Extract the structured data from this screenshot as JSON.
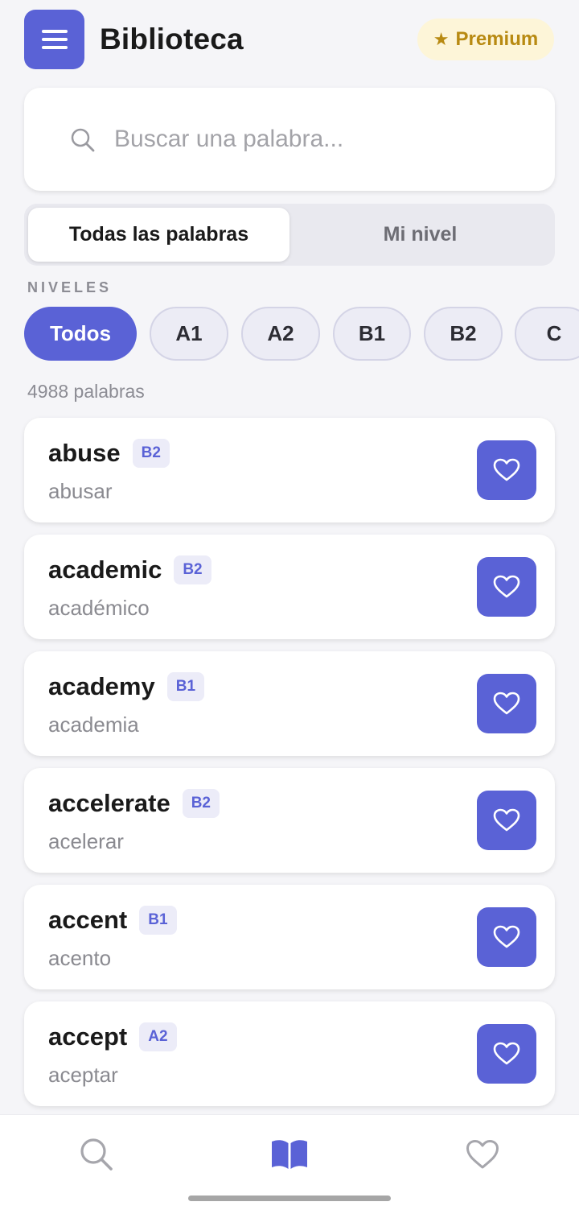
{
  "header": {
    "title": "Biblioteca",
    "premium_label": "Premium"
  },
  "search": {
    "placeholder": "Buscar una palabra...",
    "value": ""
  },
  "tabs": [
    {
      "label": "Todas las palabras",
      "active": true
    },
    {
      "label": "Mi nivel",
      "active": false
    }
  ],
  "levels": {
    "section_label": "NIVELES",
    "chips": [
      {
        "label": "Todos",
        "active": true
      },
      {
        "label": "A1",
        "active": false
      },
      {
        "label": "A2",
        "active": false
      },
      {
        "label": "B1",
        "active": false
      },
      {
        "label": "B2",
        "active": false
      },
      {
        "label": "C",
        "active": false
      }
    ]
  },
  "word_count": "4988 palabras",
  "words": [
    {
      "word": "abuse",
      "level": "B2",
      "translation": "abusar"
    },
    {
      "word": "academic",
      "level": "B2",
      "translation": "académico"
    },
    {
      "word": "academy",
      "level": "B1",
      "translation": "academia"
    },
    {
      "word": "accelerate",
      "level": "B2",
      "translation": "acelerar"
    },
    {
      "word": "accent",
      "level": "B1",
      "translation": "acento"
    },
    {
      "word": "accept",
      "level": "A2",
      "translation": "aceptar"
    }
  ],
  "bottom_nav": [
    {
      "icon": "search-icon",
      "active": false
    },
    {
      "icon": "book-icon",
      "active": true
    },
    {
      "icon": "heart-icon",
      "active": false
    }
  ],
  "colors": {
    "accent": "#5a62d6",
    "premium_text": "#b88a12",
    "premium_bg": "#fdf5d8",
    "inactive_icon": "#a6a6ac"
  }
}
